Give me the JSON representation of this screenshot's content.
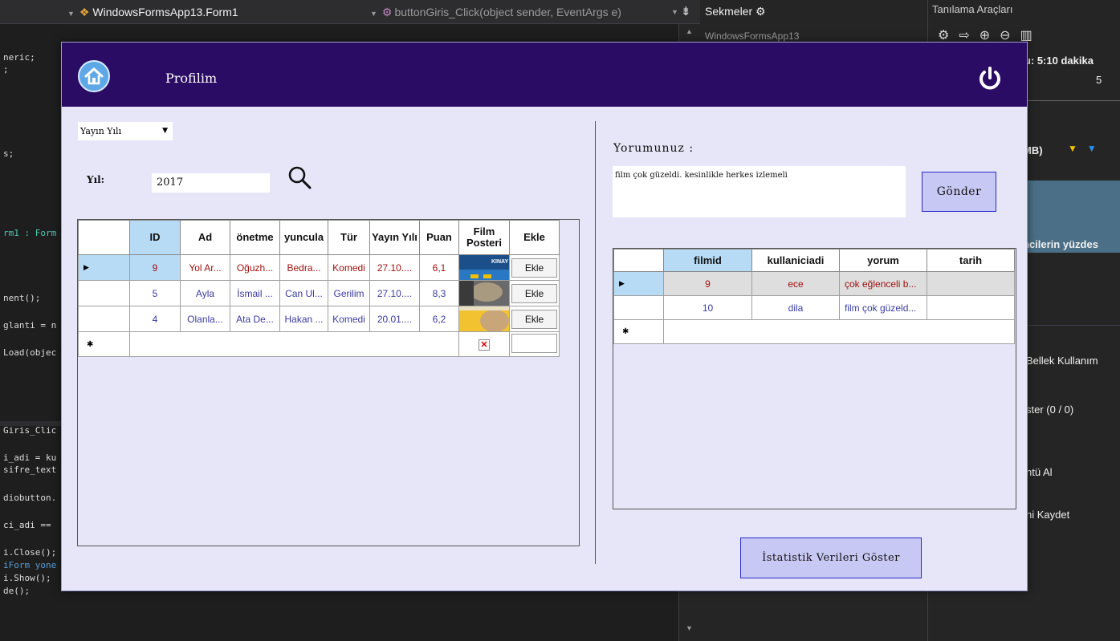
{
  "ide": {
    "class_combo": "WindowsFormsApp13.Form1",
    "member_combo": "buttonGiris_Click(object sender, EventArgs e)",
    "tabs_title": "Sekmeler",
    "tabs_item": "WindowsFormsApp13",
    "code_lines": [
      "neric;",
      ";",
      "s;",
      "rm1 : Form",
      "nent();",
      "glanti = n",
      "Load(objec",
      "Giris_Clic",
      "i_adi = ku",
      "sifre_text",
      "diobutton.",
      "ci_adi ==",
      "i.Close();",
      "iForm yone",
      "i.Show();",
      "de();"
    ],
    "diag_title": "Tanılama Araçları",
    "diag_session": "nu: 5:10 dakika",
    "diag_tick": "5",
    "diag_mb": "MB)",
    "diag_users": "ncilerin yüzdes",
    "diag_memory": "Bellek Kullanım",
    "diag_show": "ster (0 / 0)",
    "diag_snapshot": "ntü Al",
    "diag_save": "ni Kaydet"
  },
  "form": {
    "title": "Profilim",
    "filter": {
      "combo_value": "Yayın Yılı",
      "year_label": "Yıl:",
      "year_value": "2017"
    },
    "movies_grid": {
      "columns": [
        "ID",
        "Ad",
        "önetme",
        "yuncula",
        "Tür",
        "Yayın Yılı",
        "Puan",
        "Film Posteri",
        "Ekle"
      ],
      "rows": [
        {
          "id": "9",
          "ad": "Yol Ar...",
          "yonetmen": "Oğuzh...",
          "oyuncu": "Bedra...",
          "tur": "Komedi",
          "yil": "27.10....",
          "puan": "6,1",
          "ekle": "Ekle"
        },
        {
          "id": "5",
          "ad": "Ayla",
          "yonetmen": "İsmail ...",
          "oyuncu": "Can Ul...",
          "tur": "Gerilim",
          "yil": "27.10....",
          "puan": "8,3",
          "ekle": "Ekle"
        },
        {
          "id": "4",
          "ad": "Olanla...",
          "yonetmen": "Ata De...",
          "oyuncu": "Hakan ...",
          "tur": "Komedi",
          "yil": "20.01....",
          "puan": "6,2",
          "ekle": "Ekle"
        }
      ],
      "poster1_text": "KINAY"
    },
    "comment": {
      "label": "Yorumunuz :",
      "value": "film çok güzeldi. kesinlikle herkes izlemeli",
      "send_button": "Gönder"
    },
    "comments_grid": {
      "columns": [
        "filmid",
        "kullaniciadi",
        "yorum",
        "tarih"
      ],
      "rows": [
        {
          "filmid": "9",
          "kullanici": "ece",
          "yorum": "çok eğlenceli b...",
          "tarih": ""
        },
        {
          "filmid": "10",
          "kullanici": "dila",
          "yorum": "film çok güzeld...",
          "tarih": ""
        }
      ]
    },
    "stats_button": "İstatistik Verileri Göster"
  }
}
